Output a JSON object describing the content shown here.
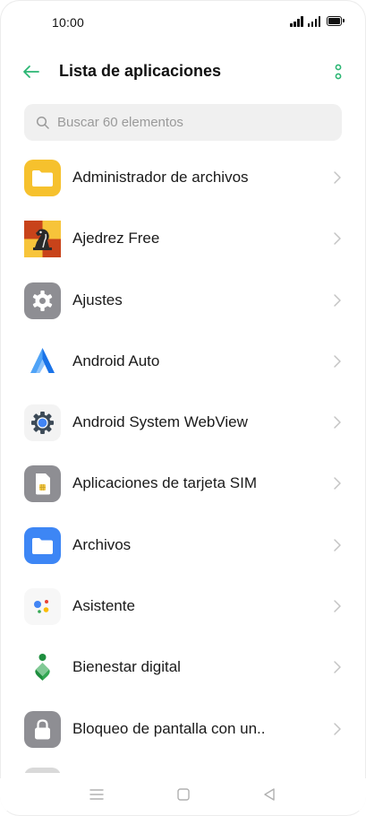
{
  "status_bar": {
    "time": "10:00"
  },
  "header": {
    "title": "Lista de aplicaciones"
  },
  "search": {
    "placeholder": "Buscar 60 elementos"
  },
  "apps": [
    {
      "label": "Administrador de archivos",
      "icon": "folder-yellow-icon"
    },
    {
      "label": "Ajedrez Free",
      "icon": "chess-icon"
    },
    {
      "label": "Ajustes",
      "icon": "settings-gear-icon"
    },
    {
      "label": "Android Auto",
      "icon": "android-auto-icon"
    },
    {
      "label": "Android System WebView",
      "icon": "webview-gear-icon"
    },
    {
      "label": "Aplicaciones de tarjeta SIM",
      "icon": "sim-card-icon"
    },
    {
      "label": "Archivos",
      "icon": "folder-blue-icon"
    },
    {
      "label": "Asistente",
      "icon": "assistant-icon"
    },
    {
      "label": "Bienestar digital",
      "icon": "digital-wellbeing-icon"
    },
    {
      "label": "Bloqueo de pantalla con un..",
      "icon": "lock-icon"
    }
  ],
  "colors": {
    "accent": "#2bb673",
    "chevron": "#c4c4c4",
    "search_bg": "#f0f0f0"
  }
}
